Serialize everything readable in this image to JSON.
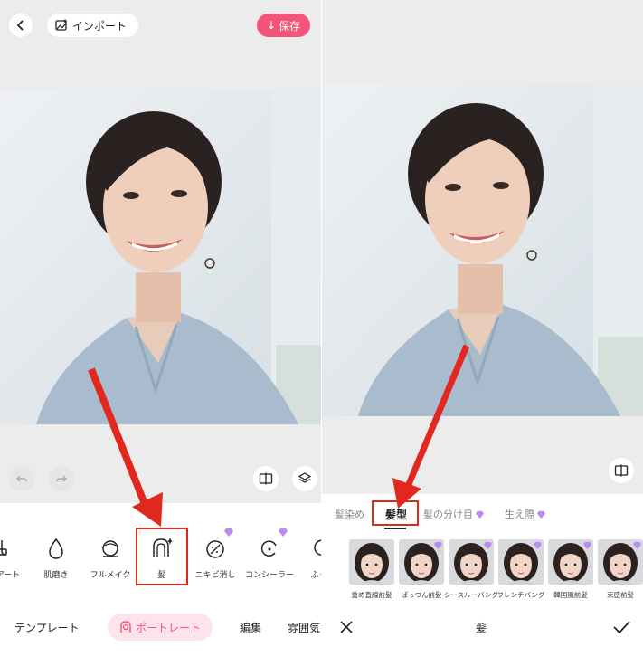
{
  "left": {
    "top_bar": {
      "import_label": "インポート",
      "save_label": "保存"
    },
    "tools": [
      {
        "label": "アート",
        "icon": "art-icon"
      },
      {
        "label": "肌磨き",
        "icon": "drop-icon"
      },
      {
        "label": "フルメイク",
        "icon": "makeup-icon"
      },
      {
        "label": "髪",
        "icon": "hair-icon",
        "selected": true
      },
      {
        "label": "ニキビ消し",
        "icon": "acne-icon",
        "premium": true
      },
      {
        "label": "コンシーラー",
        "icon": "concealer-icon",
        "premium": true
      },
      {
        "label": "ふっく",
        "icon": "plump-icon"
      }
    ],
    "nav": {
      "template": "テンプレート",
      "portrait": "ポートレート",
      "edit": "編集",
      "mood": "雰囲気"
    }
  },
  "right": {
    "tabs": [
      {
        "label": "髪染め"
      },
      {
        "label": "髪型",
        "active": true
      },
      {
        "label": "髪の分け目",
        "premium": true
      },
      {
        "label": "生え際",
        "premium": true
      }
    ],
    "styles": [
      {
        "label": "重め直線前髪",
        "premium": false
      },
      {
        "label": "ぱっつん前髪",
        "premium": true
      },
      {
        "label": "シースルーバング",
        "premium": true
      },
      {
        "label": "フレンチバング",
        "premium": true
      },
      {
        "label": "韓国風前髪",
        "premium": true
      },
      {
        "label": "束感前髪",
        "premium": true
      }
    ],
    "bottom_bar": {
      "title": "髪"
    }
  },
  "colors": {
    "accent": "#f4547a",
    "highlight": "#e0281e",
    "premium_gem": "#b88cf0"
  }
}
